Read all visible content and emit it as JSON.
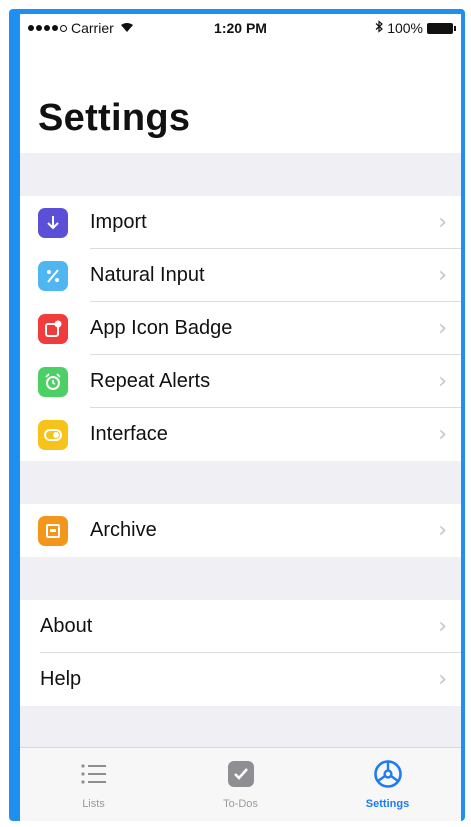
{
  "status_bar": {
    "carrier": "Carrier",
    "time": "1:20 PM",
    "battery": "100%"
  },
  "title": "Settings",
  "groups": [
    {
      "rows": [
        {
          "label": "Import",
          "icon": "download-icon",
          "color": "#5b4fd8"
        },
        {
          "label": "Natural Input",
          "icon": "percent-icon",
          "color": "#4fb6f2"
        },
        {
          "label": "App Icon Badge",
          "icon": "badge-icon",
          "color": "#f03c3c"
        },
        {
          "label": "Repeat Alerts",
          "icon": "alarm-icon",
          "color": "#4cd066"
        },
        {
          "label": "Interface",
          "icon": "toggle-icon",
          "color": "#f7c21a"
        }
      ]
    },
    {
      "rows": [
        {
          "label": "Archive",
          "icon": "archive-icon",
          "color": "#f3961c"
        }
      ]
    },
    {
      "rows": [
        {
          "label": "About"
        },
        {
          "label": "Help"
        }
      ]
    }
  ],
  "tabs": [
    {
      "label": "Lists",
      "icon": "list-icon",
      "active": false
    },
    {
      "label": "To-Dos",
      "icon": "checkmark-icon",
      "active": false
    },
    {
      "label": "Settings",
      "icon": "settings-icon",
      "active": true
    }
  ],
  "colors": {
    "accent": "#1e7cf2",
    "group_background": "#efeff4"
  }
}
